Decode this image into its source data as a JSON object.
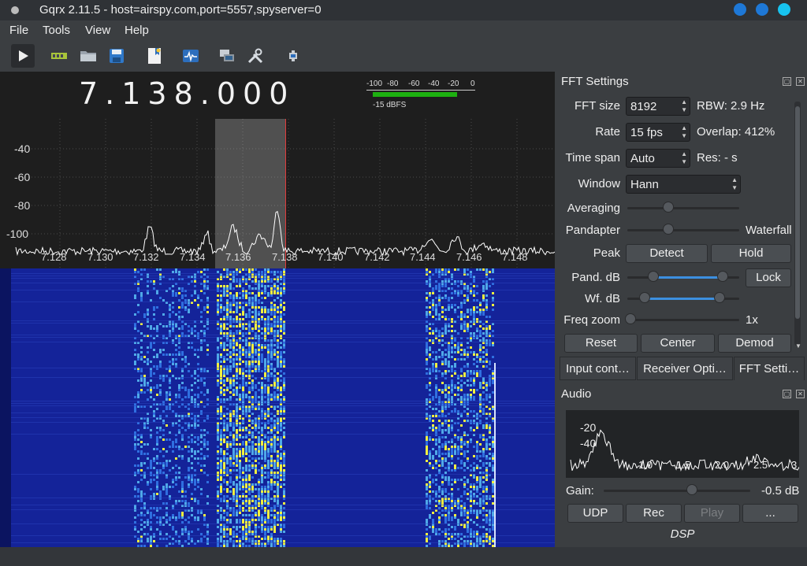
{
  "window": {
    "title": "Gqrx 2.11.5 - host=airspy.com,port=5557,spyserver=0"
  },
  "menubar": {
    "items": [
      "File",
      "Tools",
      "View",
      "Help"
    ]
  },
  "toolbar": {
    "buttons": [
      "play-icon",
      "hardware-icon",
      "open-folder-icon",
      "save-icon",
      "bookmark-icon",
      "fft-icon",
      "remote-icon",
      "tools-icon",
      "settings-icon"
    ]
  },
  "frequency": {
    "display": "7.138.000"
  },
  "smeter": {
    "ticks": [
      "-100",
      "-80",
      "-60",
      "-40",
      "-20",
      "0"
    ],
    "label": "-15 dBFS",
    "level_fraction": 0.85
  },
  "pandapter": {
    "y_ticks": [
      "-40",
      "-60",
      "-80",
      "-100"
    ],
    "x_ticks": [
      "7.128",
      "7.130",
      "7.132",
      "7.134",
      "7.136",
      "7.138",
      "7.140",
      "7.142",
      "7.144",
      "7.146",
      "7.148"
    ],
    "colors": {
      "background": "#1e1e1e",
      "trace": "#ffffff",
      "filter": "#c8c8c8",
      "marker": "#e03a3a"
    }
  },
  "waterfall": {
    "colors": {
      "low": "#142399",
      "mid": "#2f6fe0",
      "high": "#f0f040"
    }
  },
  "fft_settings": {
    "title": "FFT Settings",
    "fft_size_label": "FFT size",
    "fft_size_value": "8192",
    "rbw": "RBW: 2.9 Hz",
    "rate_label": "Rate",
    "rate_value": "15 fps",
    "overlap": "Overlap: 412%",
    "timespan_label": "Time span",
    "timespan_value": "Auto",
    "res": "Res: - s",
    "window_label": "Window",
    "window_value": "Hann",
    "averaging_label": "Averaging",
    "pandapter_label": "Pandapter",
    "waterfall_label": "Waterfall",
    "peak_label": "Peak",
    "detect_button": "Detect",
    "hold_button": "Hold",
    "pand_db_label": "Pand. dB",
    "lock_button": "Lock",
    "wf_db_label": "Wf. dB",
    "freq_zoom_label": "Freq zoom",
    "freq_zoom_value": "1x",
    "reset_button": "Reset",
    "center_button": "Center",
    "demod_button": "Demod"
  },
  "tabs": [
    "Input cont…",
    "Receiver Opti…",
    "FFT Setti…"
  ],
  "audio": {
    "title": "Audio",
    "plot_y_ticks": [
      "-20",
      "-40"
    ],
    "plot_x_ticks": [
      "1.0",
      "1.5",
      "2.0",
      "2.5",
      "3"
    ],
    "gain_label": "Gain:",
    "gain_value": "-0.5 dB",
    "udp_button": "UDP",
    "rec_button": "Rec",
    "play_button": "Play",
    "more_button": "...",
    "dsp_label": "DSP"
  }
}
